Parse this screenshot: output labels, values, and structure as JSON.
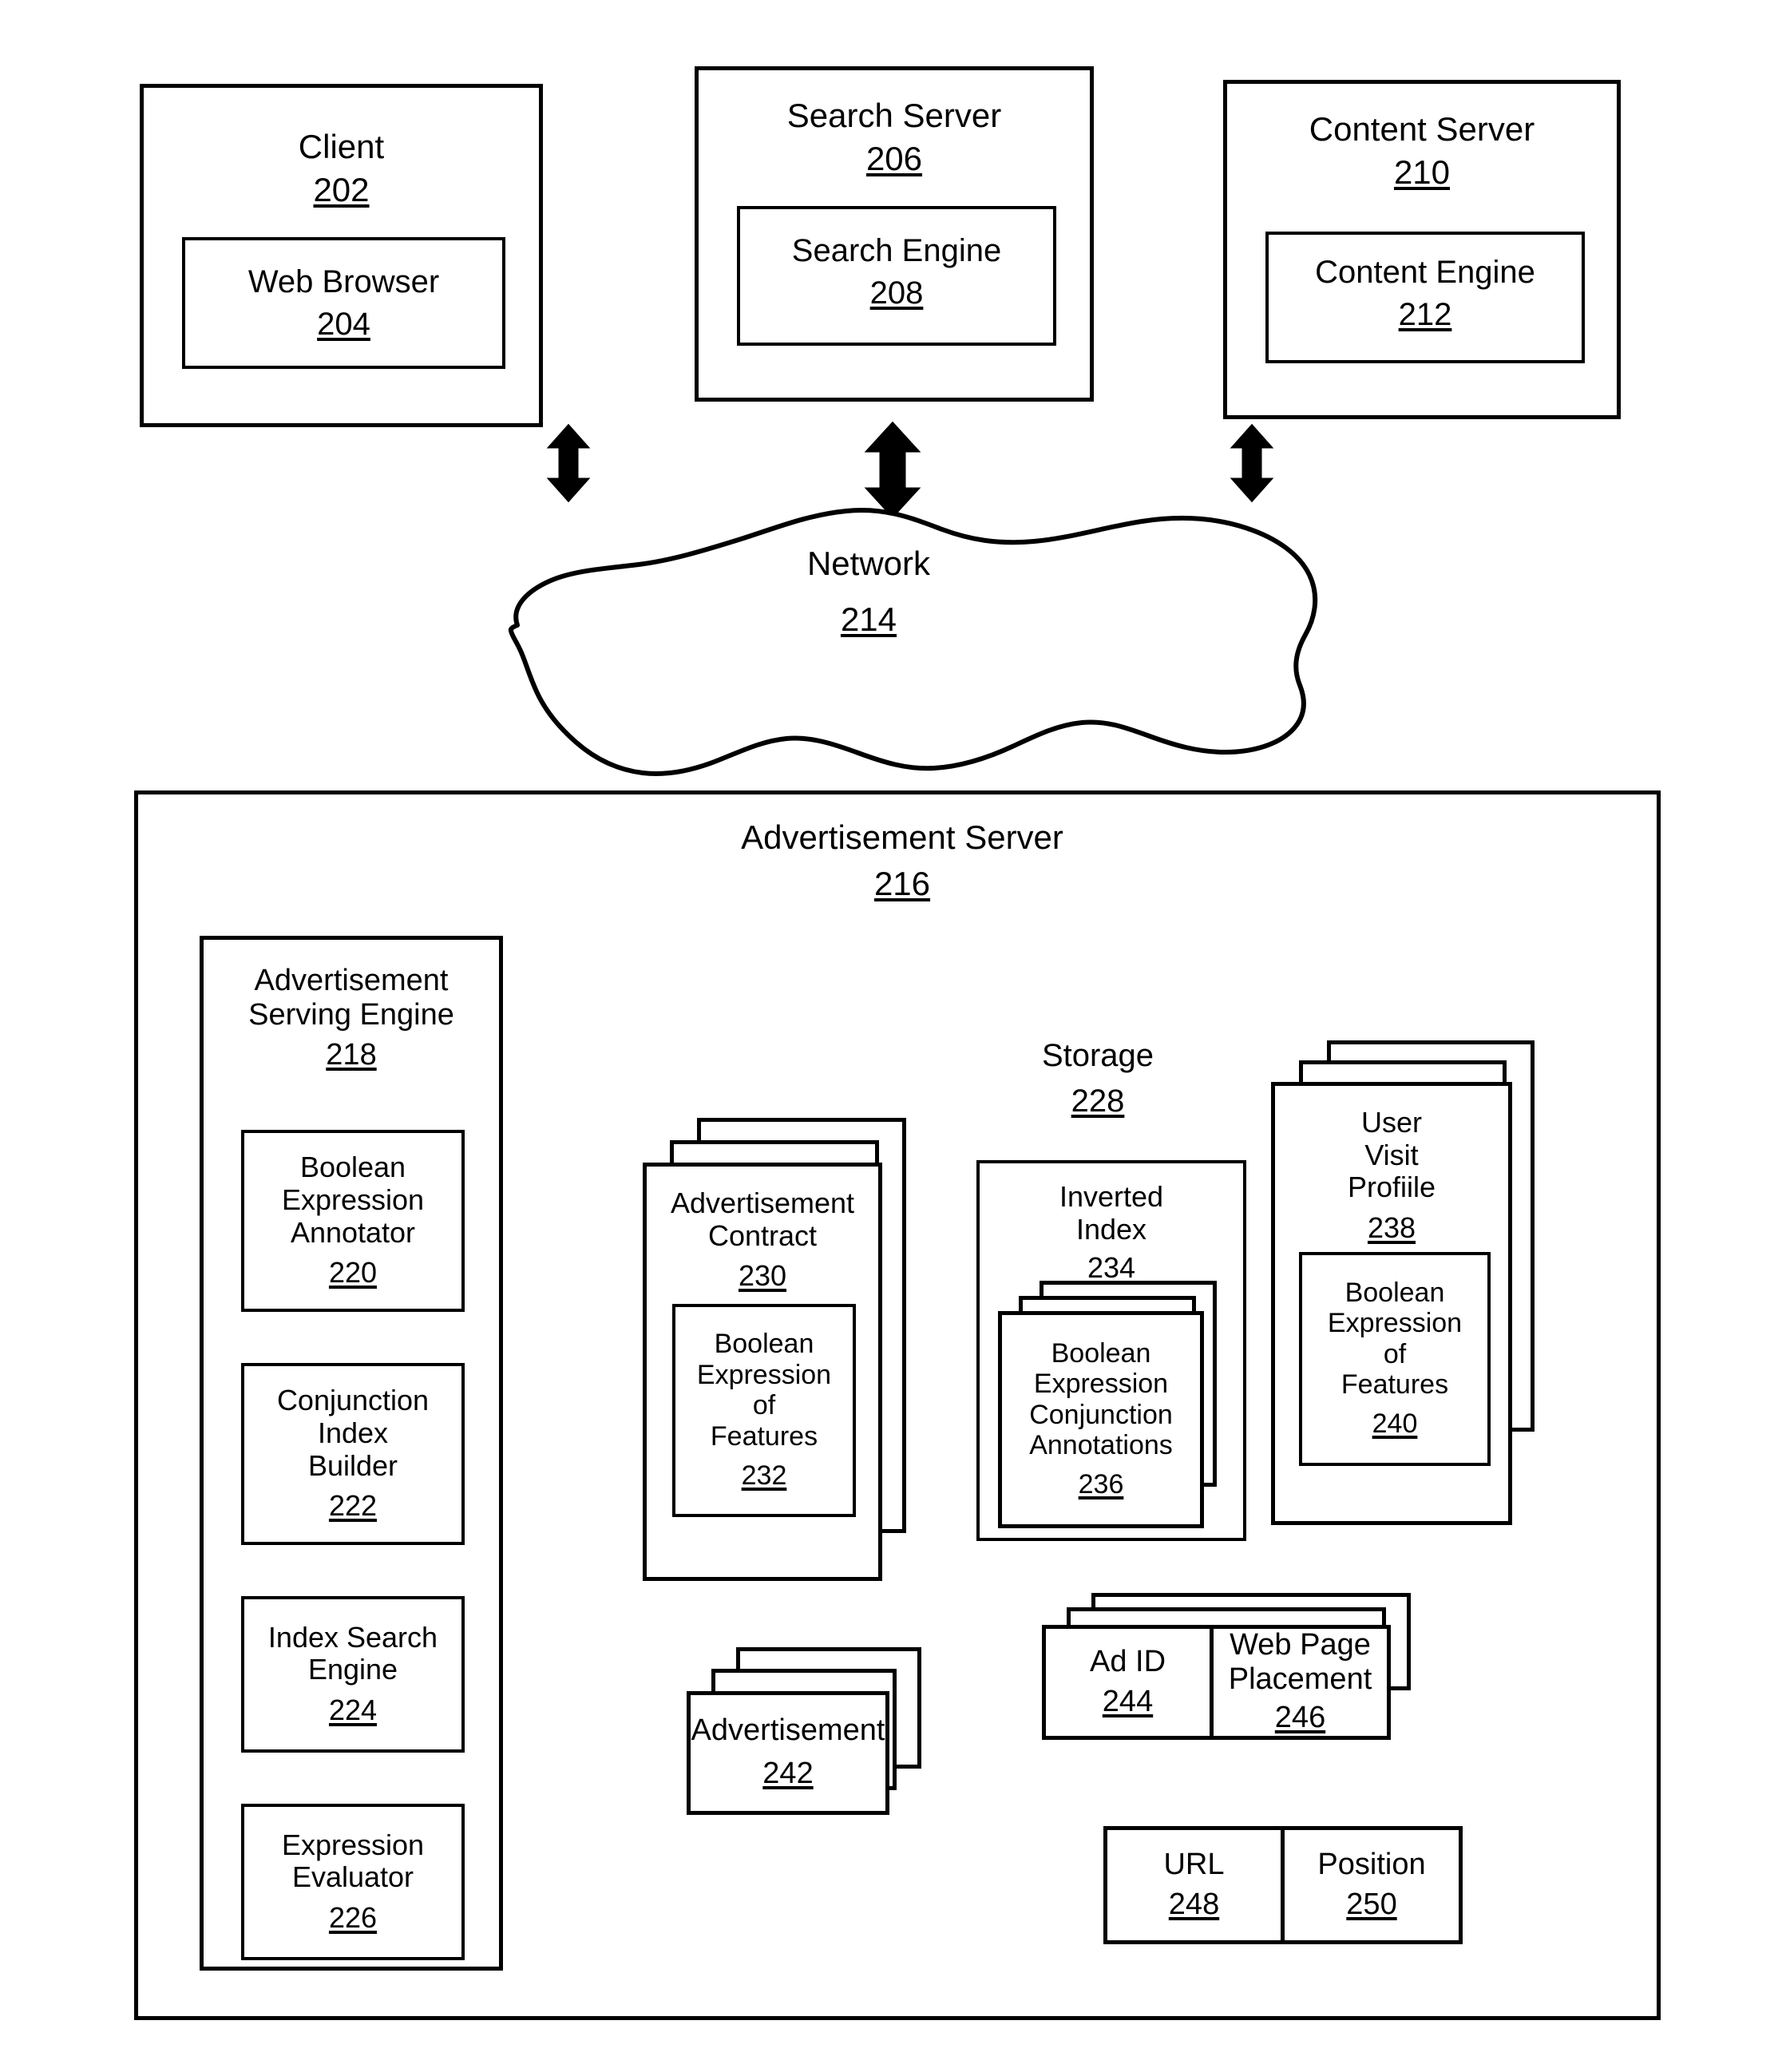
{
  "figure": {
    "top_nodes": [
      {
        "id": "client",
        "label": "Client",
        "number": "202"
      },
      {
        "id": "search-server",
        "label": "Search Server",
        "number": "206"
      },
      {
        "id": "content-server",
        "label": "Content Server",
        "number": "210"
      }
    ],
    "top_children": [
      {
        "id": "web-browser",
        "label": "Web Browser",
        "number": "204"
      },
      {
        "id": "search-engine",
        "label": "Search Engine",
        "number": "208"
      },
      {
        "id": "content-engine",
        "label": "Content Engine",
        "number": "212"
      }
    ],
    "network": {
      "label": "Network",
      "number": "214"
    },
    "ad_server": {
      "label": "Advertisement Server",
      "number": "216"
    },
    "serving_engine": {
      "label": "Advertisement\nServing Engine",
      "number": "218"
    },
    "serving_engine_children": [
      {
        "id": "boolean-expression-annotator",
        "label": "Boolean\nExpression\nAnnotator",
        "number": "220"
      },
      {
        "id": "conjunction-index-builder",
        "label": "Conjunction\nIndex\nBuilder",
        "number": "222"
      },
      {
        "id": "index-search-engine",
        "label": "Index Search\nEngine",
        "number": "224"
      },
      {
        "id": "expression-evaluator",
        "label": "Expression\nEvaluator",
        "number": "226"
      }
    ],
    "storage": {
      "label": "Storage",
      "number": "228"
    },
    "storage_items": [
      {
        "id": "advertisement-contract",
        "label": "Advertisement\nContract",
        "number": "230",
        "child": {
          "id": "boolean-expression-of-features-232",
          "label": "Boolean\nExpression\nof\nFeatures",
          "number": "232"
        }
      },
      {
        "id": "inverted-index",
        "label": "Inverted\nIndex",
        "number": "234",
        "child": {
          "id": "boolean-expression-conjunction-annotations",
          "label": "Boolean\nExpression\nConjunction\nAnnotations",
          "number": "236"
        }
      },
      {
        "id": "user-visit-profile",
        "label": "User\nVisit\nProfiile",
        "number": "238",
        "child": {
          "id": "boolean-expression-of-features-240",
          "label": "Boolean\nExpression\nof\nFeatures",
          "number": "240"
        }
      },
      {
        "id": "advertisement",
        "label": "Advertisement",
        "number": "242",
        "child": null
      }
    ],
    "placement_record": {
      "cells": [
        {
          "id": "ad-id",
          "label": "Ad ID",
          "number": "244"
        },
        {
          "id": "web-page-placement",
          "label": "Web Page\nPlacement",
          "number": "246"
        }
      ]
    },
    "placement_detail": {
      "cells": [
        {
          "id": "url",
          "label": "URL",
          "number": "248"
        },
        {
          "id": "position",
          "label": "Position",
          "number": "250"
        }
      ]
    },
    "arrows": [
      {
        "id": "arrow-client-network",
        "direction": "both"
      },
      {
        "id": "arrow-search-server-network",
        "direction": "both"
      },
      {
        "id": "arrow-content-server-network",
        "direction": "both"
      },
      {
        "id": "arrow-network-ad-server",
        "direction": "both"
      }
    ],
    "colors": {
      "line": "#000000",
      "background": "#ffffff"
    }
  }
}
